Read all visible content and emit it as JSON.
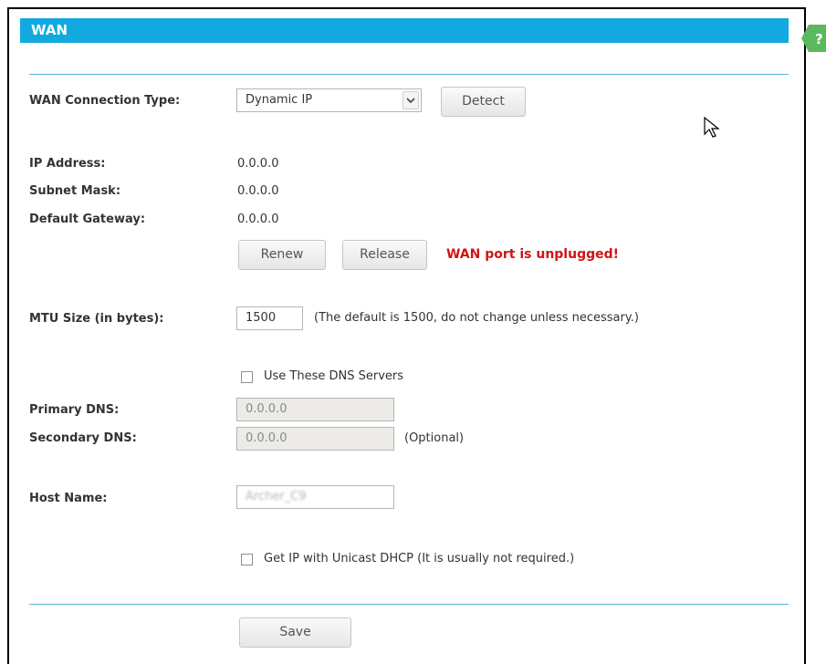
{
  "header": {
    "title": "WAN"
  },
  "form": {
    "connection_type_label": "WAN Connection Type:",
    "connection_type_value": "Dynamic IP",
    "detect_label": "Detect",
    "ip_label": "IP Address:",
    "ip_value": "0.0.0.0",
    "subnet_label": "Subnet Mask:",
    "subnet_value": "0.0.0.0",
    "gateway_label": "Default Gateway:",
    "gateway_value": "0.0.0.0",
    "renew_label": "Renew",
    "release_label": "Release",
    "status_message": "WAN port is unplugged!",
    "mtu_label": "MTU Size (in bytes):",
    "mtu_value": "1500",
    "mtu_hint": "(The default is 1500, do not change unless necessary.)",
    "use_dns_label": "Use These DNS Servers",
    "primary_dns_label": "Primary DNS:",
    "primary_dns_value": "0.0.0.0",
    "secondary_dns_label": "Secondary DNS:",
    "secondary_dns_value": "0.0.0.0",
    "secondary_dns_hint": "(Optional)",
    "host_name_label": "Host Name:",
    "host_name_value": "Archer_C9",
    "unicast_label": "Get IP with Unicast DHCP (It is usually not required.)",
    "save_label": "Save"
  },
  "colors": {
    "header_bg": "#12a9e0",
    "rule": "#5bb4dc",
    "warning": "#d21414",
    "help_badge": "#5cb85c"
  },
  "icons": {
    "help": "help-question-icon",
    "dropdown": "chevron-down-icon",
    "cursor": "mouse-pointer-icon"
  }
}
